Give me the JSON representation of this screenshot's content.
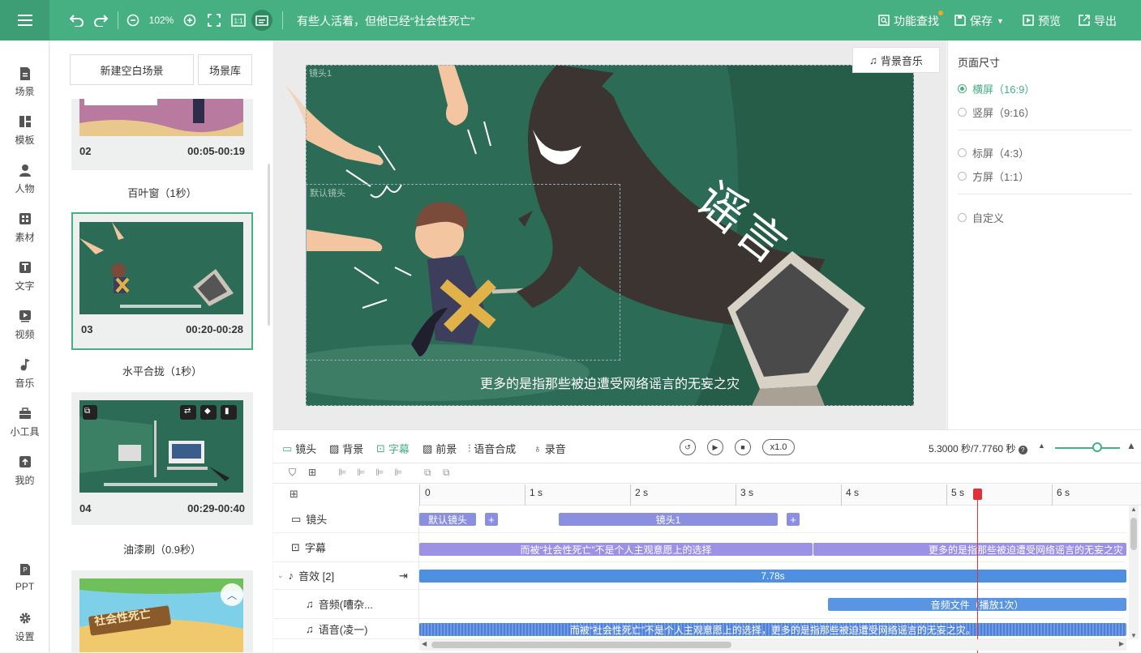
{
  "topbar": {
    "zoom": "102%",
    "title": "有些人活着，但他已经“社会性死亡”",
    "feature_search": "功能查找",
    "save": "保存",
    "preview": "预览",
    "export": "导出"
  },
  "nav": {
    "items": [
      {
        "label": "场景",
        "icon": "scene-icon"
      },
      {
        "label": "模板",
        "icon": "template-icon"
      },
      {
        "label": "人物",
        "icon": "person-icon"
      },
      {
        "label": "素材",
        "icon": "material-icon"
      },
      {
        "label": "文字",
        "icon": "text-icon"
      },
      {
        "label": "视频",
        "icon": "video-icon"
      },
      {
        "label": "音乐",
        "icon": "music-icon"
      },
      {
        "label": "小工具",
        "icon": "toolbox-icon"
      },
      {
        "label": "我的",
        "icon": "upload-icon"
      }
    ],
    "ppt": "PPT",
    "settings": "设置"
  },
  "scenes": {
    "new_blank": "新建空白场景",
    "library": "场景库",
    "cards": [
      {
        "num": "02",
        "time": "00:05-00:19",
        "transition": "百叶窗（1秒）"
      },
      {
        "num": "03",
        "time": "00:20-00:28",
        "transition": "水平合拢（1秒）",
        "selected": true
      },
      {
        "num": "04",
        "time": "00:29-00:40",
        "transition": "油漆刷（0.9秒）"
      }
    ],
    "card5_sign": "社会性死亡"
  },
  "canvas": {
    "bgm": "背景音乐",
    "lens1_label": "镜头1",
    "default_lens_label": "默认镜头",
    "subtitle": "更多的是指那些被迫遭受网络谣言的无妄之灾",
    "rumor_text": "谣言"
  },
  "props": {
    "title": "页面尺寸",
    "options": [
      {
        "label": "横屏（16:9）",
        "selected": true
      },
      {
        "label": "竖屏（9:16）",
        "selected": false
      },
      {
        "label": "标屏（4:3）",
        "selected": false
      },
      {
        "label": "方屏（1:1）",
        "selected": false
      },
      {
        "label": "自定义",
        "selected": false
      }
    ]
  },
  "timeline": {
    "tabs": [
      "镜头",
      "背景",
      "字幕",
      "前景",
      "语音合成",
      "录音"
    ],
    "active_tab": "字幕",
    "speed": "x1.0",
    "time_display": "5.3000 秒/7.7760 秒",
    "ruler": [
      "0",
      "1 s",
      "2 s",
      "3 s",
      "4 s",
      "5 s",
      "6 s"
    ],
    "playhead_seconds": 5.3,
    "tracks": {
      "lens": "镜头",
      "subtitle": "字幕",
      "sfx": "音效 [2]",
      "audio": "音频(嘈杂...",
      "voice": "语音(凌一)"
    },
    "clips": {
      "default_lens": "默认镜头",
      "lens1": "镜头1",
      "sub1": "而被“社会性死亡”不是个人主观意愿上的选择",
      "sub2": "更多的是指那些被迫遭受网络谣言的无妄之灾",
      "sfx": "7.78s",
      "audio_file": "音频文件（播放1次）",
      "voice": "而被“社会性死亡”不是个人主观意愿上的选择，更多的是指那些被迫遭受网络谣言的无妄之灾。"
    }
  },
  "colors": {
    "brand": "#46b083",
    "stage": "#2c6b55",
    "playhead": "#e0303a"
  }
}
